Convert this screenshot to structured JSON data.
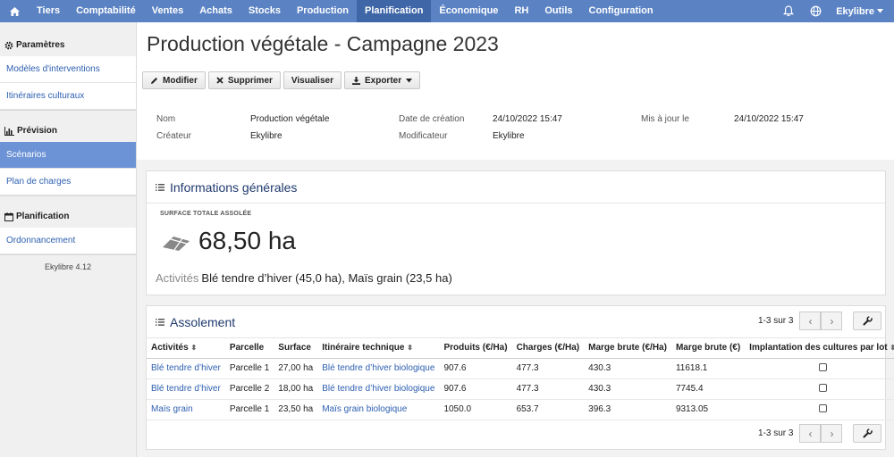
{
  "nav": {
    "items": [
      {
        "label": "Tiers",
        "active": false
      },
      {
        "label": "Comptabilité",
        "active": false
      },
      {
        "label": "Ventes",
        "active": false
      },
      {
        "label": "Achats",
        "active": false
      },
      {
        "label": "Stocks",
        "active": false
      },
      {
        "label": "Production",
        "active": false
      },
      {
        "label": "Planification",
        "active": true
      },
      {
        "label": "Économique",
        "active": false
      },
      {
        "label": "RH",
        "active": false
      },
      {
        "label": "Outils",
        "active": false
      },
      {
        "label": "Configuration",
        "active": false
      }
    ],
    "user": "Ekylibre"
  },
  "sidebar": {
    "sections": [
      {
        "title": "Paramètres",
        "icon": "gear-icon",
        "items": [
          {
            "label": "Modèles d'interventions",
            "active": false
          },
          {
            "label": "Itinéraires culturaux",
            "active": false
          }
        ]
      },
      {
        "title": "Prévision",
        "icon": "bar-chart-icon",
        "items": [
          {
            "label": "Scénarios",
            "active": true
          },
          {
            "label": "Plan de charges",
            "active": false
          }
        ]
      },
      {
        "title": "Planification",
        "icon": "calendar-icon",
        "items": [
          {
            "label": "Ordonnancement",
            "active": false
          }
        ]
      }
    ],
    "version": "Ekylibre 4.12"
  },
  "page": {
    "title": "Production végétale - Campagne 2023"
  },
  "toolbar": {
    "modify": "Modifier",
    "delete": "Supprimer",
    "view": "Visualiser",
    "export": "Exporter"
  },
  "meta": {
    "name_label": "Nom",
    "name_value": "Production végétale",
    "creator_label": "Créateur",
    "creator_value": "Ekylibre",
    "created_label": "Date de création",
    "created_value": "24/10/2022 15:47",
    "modifier_label": "Modificateur",
    "modifier_value": "Ekylibre",
    "updated_label": "Mis à jour le",
    "updated_value": "24/10/2022 15:47"
  },
  "general": {
    "title": "Informations générales",
    "surface_label": "SURFACE TOTALE ASSOLÉE",
    "surface_value": "68,50 ha",
    "activities_label": "Activités",
    "activities_value": "Blé tendre d’hiver (45,0 ha), Maïs grain (23,5 ha)"
  },
  "assolement": {
    "title": "Assolement",
    "pager": "1-3 sur 3",
    "columns": [
      "Activités",
      "Parcelle",
      "Surface",
      "Itinéraire technique",
      "Produits (€/Ha)",
      "Charges (€/Ha)",
      "Marge brute (€/Ha)",
      "Marge brute (€)",
      "Implantation des cultures par lot"
    ],
    "rows": [
      [
        "Blé tendre d’hiver",
        "Parcelle 1",
        "27,00 ha",
        "Blé tendre d’hiver biologique",
        "907.6",
        "477.3",
        "430.3",
        "11618.1"
      ],
      [
        "Blé tendre d’hiver",
        "Parcelle 2",
        "18,00 ha",
        "Blé tendre d’hiver biologique",
        "907.6",
        "477.3",
        "430.3",
        "7745.4"
      ],
      [
        "Maïs grain",
        "Parcelle 1",
        "23,50 ha",
        "Maïs grain biologique",
        "1050.0",
        "653.7",
        "396.3",
        "9313.05"
      ]
    ]
  }
}
